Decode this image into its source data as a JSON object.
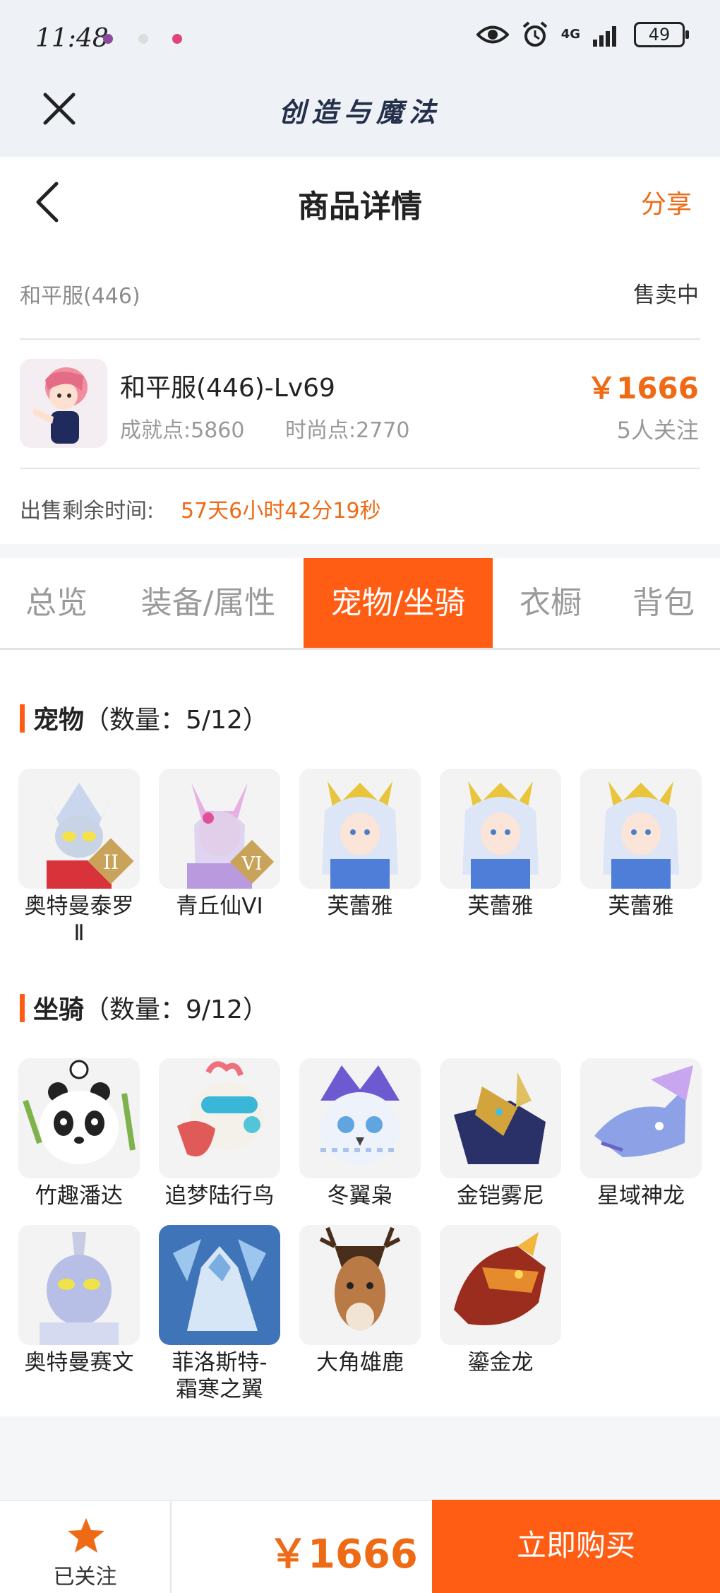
{
  "status_bar": {
    "time": "11:48",
    "network": "4G",
    "battery": "49"
  },
  "app_bar": {
    "title": "创造与魔法"
  },
  "header": {
    "title": "商品详情",
    "share_label": "分享"
  },
  "product": {
    "server": "和平服(446)",
    "status": "售卖中",
    "name": "和平服(446)-Lv69",
    "achievement": "成就点:5860",
    "fashion": "时尚点:2770",
    "price": "￥1666",
    "followers": "5人关注",
    "remaining_label": "出售剩余时间:",
    "remaining_value": "57天6小时42分19秒"
  },
  "tabs": [
    {
      "label": "总览",
      "active": false
    },
    {
      "label": "装备/属性",
      "active": false
    },
    {
      "label": "宠物/坐骑",
      "active": true
    },
    {
      "label": "衣橱",
      "active": false
    },
    {
      "label": "背包",
      "active": false
    }
  ],
  "pets": {
    "title": "宠物",
    "count": "（数量：5/12）",
    "items": [
      {
        "line1": "奥特曼泰罗",
        "line2": "Ⅱ",
        "badge": "II"
      },
      {
        "line1": "青丘仙VI",
        "line2": "",
        "badge": "VI"
      },
      {
        "line1": "芙蕾雅",
        "line2": ""
      },
      {
        "line1": "芙蕾雅",
        "line2": ""
      },
      {
        "line1": "芙蕾雅",
        "line2": ""
      }
    ]
  },
  "mounts": {
    "title": "坐骑",
    "count": "（数量：9/12）",
    "items": [
      {
        "line1": "竹趣潘达",
        "line2": ""
      },
      {
        "line1": "追梦陆行鸟",
        "line2": ""
      },
      {
        "line1": "冬翼枭",
        "line2": ""
      },
      {
        "line1": "金铠雾尼",
        "line2": ""
      },
      {
        "line1": "星域神龙",
        "line2": ""
      },
      {
        "line1": "奥特曼赛文",
        "line2": ""
      },
      {
        "line1": "菲洛斯特-",
        "line2": "霜寒之翼"
      },
      {
        "line1": "大角雄鹿",
        "line2": ""
      },
      {
        "line1": "鎏金龙",
        "line2": ""
      }
    ]
  },
  "bottom": {
    "follow_label": "已关注",
    "price": "￥1666",
    "buy_label": "立即购买"
  },
  "colors": {
    "accent": "#ff5d14",
    "price": "#ef6a15"
  }
}
